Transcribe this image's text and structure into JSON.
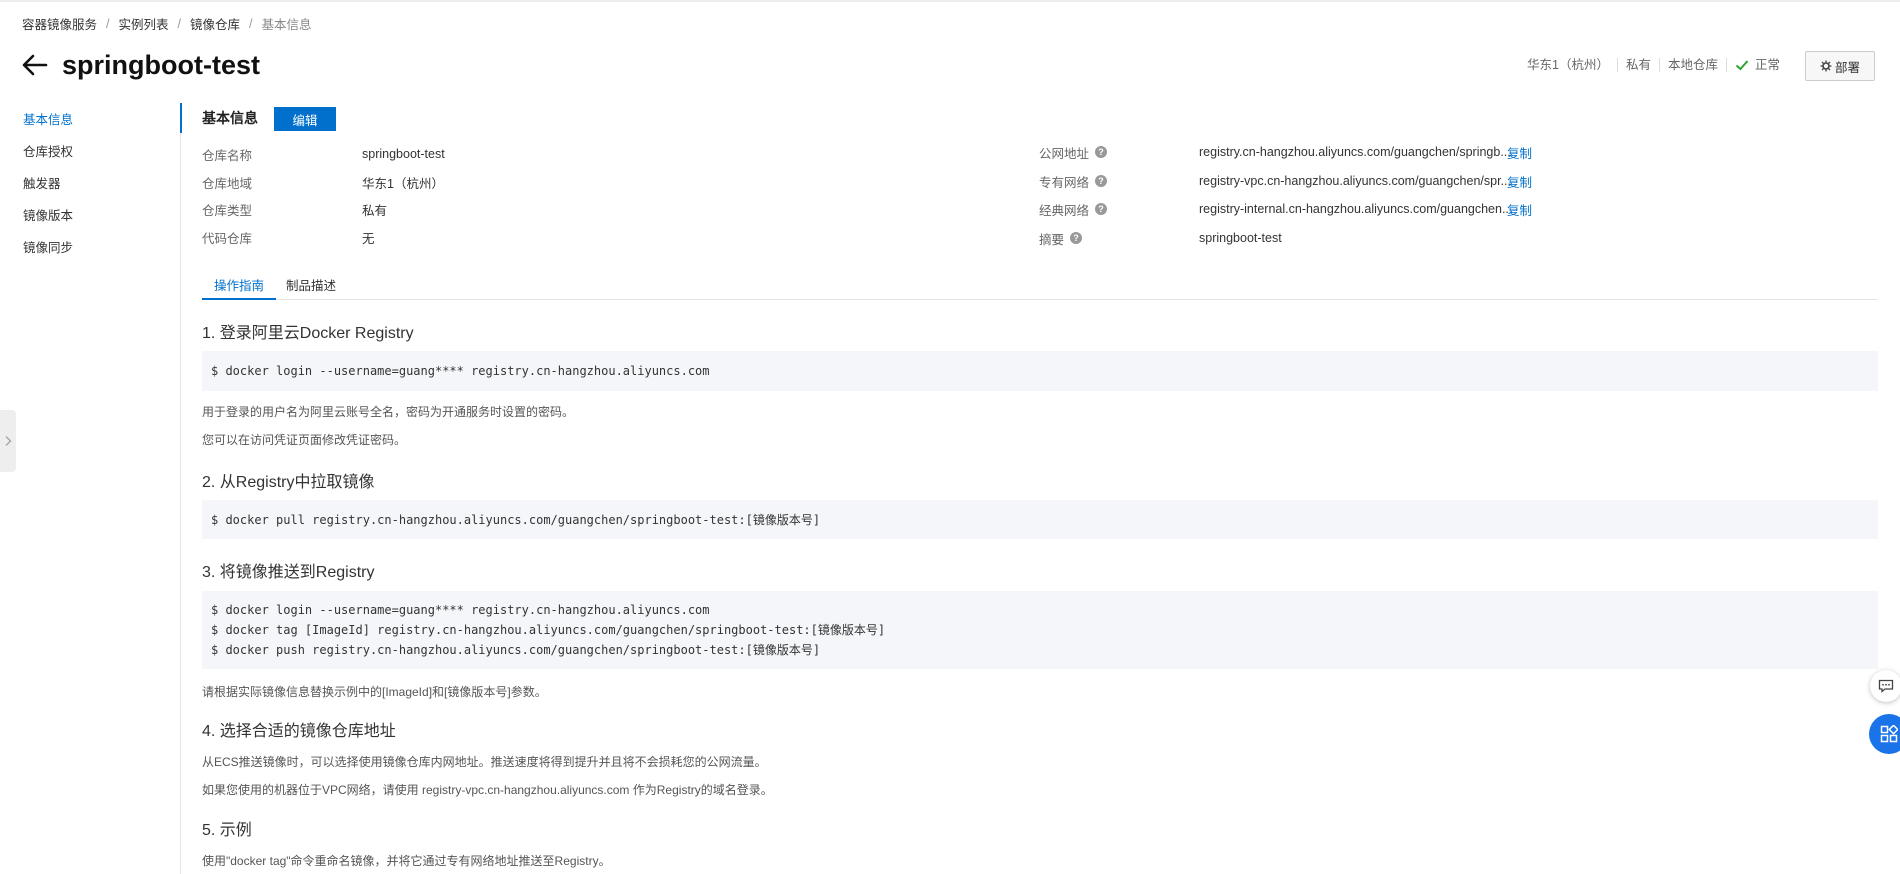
{
  "breadcrumb": {
    "items": [
      "容器镜像服务",
      "实例列表",
      "镜像仓库",
      "基本信息"
    ],
    "separator": "/"
  },
  "header": {
    "title": "springboot-test",
    "region": "华东1（杭州）",
    "visibility": "私有",
    "repo_type": "本地仓库",
    "status": "正常",
    "deploy_label": "部署"
  },
  "sidebar": {
    "items": [
      {
        "label": "基本信息",
        "active": true
      },
      {
        "label": "仓库授权"
      },
      {
        "label": "触发器"
      },
      {
        "label": "镜像版本"
      },
      {
        "label": "镜像同步"
      }
    ]
  },
  "basic_info": {
    "title": "基本信息",
    "edit_label": "编辑",
    "left": [
      {
        "label": "仓库名称",
        "value": "springboot-test"
      },
      {
        "label": "仓库地域",
        "value": "华东1（杭州）"
      },
      {
        "label": "仓库类型",
        "value": "私有"
      },
      {
        "label": "代码仓库",
        "value": "无"
      }
    ],
    "right": [
      {
        "label": "公网地址",
        "value": "registry.cn-hangzhou.aliyuncs.com/guangchen/springb...",
        "copy": "复制"
      },
      {
        "label": "专有网络",
        "value": "registry-vpc.cn-hangzhou.aliyuncs.com/guangchen/spr...",
        "copy": "复制"
      },
      {
        "label": "经典网络",
        "value": "registry-internal.cn-hangzhou.aliyuncs.com/guangchen...",
        "copy": "复制"
      },
      {
        "label": "摘要",
        "value": "springboot-test"
      }
    ]
  },
  "tabs": [
    {
      "label": "操作指南",
      "active": true
    },
    {
      "label": "制品描述"
    }
  ],
  "guide": {
    "step1": {
      "title": "1. 登录阿里云Docker Registry",
      "code": [
        "$ docker login --username=guang**** registry.cn-hangzhou.aliyuncs.com"
      ],
      "notes": [
        "用于登录的用户名为阿里云账号全名，密码为开通服务时设置的密码。",
        "您可以在访问凭证页面修改凭证密码。"
      ]
    },
    "step2": {
      "title": "2. 从Registry中拉取镜像",
      "code": [
        "$ docker pull registry.cn-hangzhou.aliyuncs.com/guangchen/springboot-test:[镜像版本号]"
      ]
    },
    "step3": {
      "title": "3. 将镜像推送到Registry",
      "code": [
        "$ docker login --username=guang**** registry.cn-hangzhou.aliyuncs.com",
        "$ docker tag [ImageId] registry.cn-hangzhou.aliyuncs.com/guangchen/springboot-test:[镜像版本号]",
        "$ docker push registry.cn-hangzhou.aliyuncs.com/guangchen/springboot-test:[镜像版本号]"
      ],
      "notes": [
        "请根据实际镜像信息替换示例中的[ImageId]和[镜像版本号]参数。"
      ]
    },
    "step4": {
      "title": "4. 选择合适的镜像仓库地址",
      "notes": [
        "从ECS推送镜像时，可以选择使用镜像仓库内网地址。推送速度将得到提升并且将不会损耗您的公网流量。",
        "如果您使用的机器位于VPC网络，请使用 registry-vpc.cn-hangzhou.aliyuncs.com 作为Registry的域名登录。"
      ]
    },
    "step5": {
      "title": "5. 示例",
      "notes": [
        "使用\"docker tag\"命令重命名镜像，并将它通过专有网络地址推送至Registry。"
      ]
    }
  },
  "colors": {
    "accent": "#0070cc",
    "status_ok": "#2ea32e",
    "code_bg": "#f4f6f9",
    "float_button": "#1a73e8"
  },
  "icons": {
    "back": "arrow-left-icon",
    "status": "check-icon",
    "deploy": "deploy-icon",
    "help": "question-circle-icon",
    "collapse": "chevron-right-icon",
    "chat": "chat-icon",
    "apps": "apps-grid-icon"
  }
}
